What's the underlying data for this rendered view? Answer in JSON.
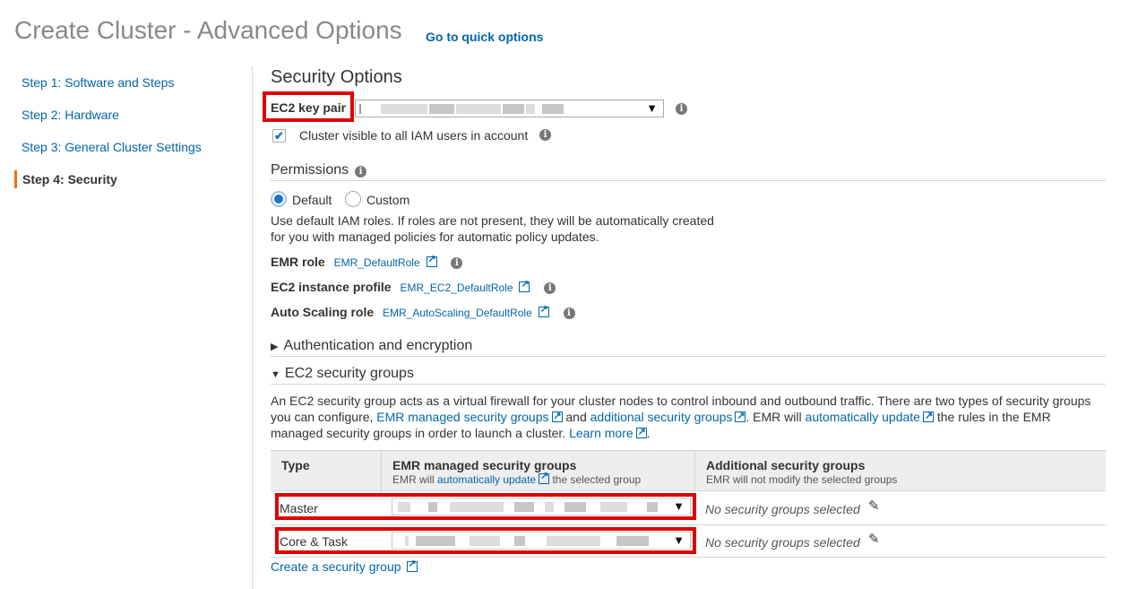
{
  "header": {
    "title": "Create Cluster - Advanced Options",
    "quick_options_link": "Go to quick options"
  },
  "steps": [
    {
      "label": "Step 1: Software and Steps",
      "active": false
    },
    {
      "label": "Step 2: Hardware",
      "active": false
    },
    {
      "label": "Step 3: General Cluster Settings",
      "active": false
    },
    {
      "label": "Step 4: Security",
      "active": true
    }
  ],
  "security": {
    "heading": "Security Options",
    "key_pair_label": "EC2 key pair",
    "key_pair_value": "",
    "cluster_visible_label": "Cluster visible to all IAM users in account",
    "cluster_visible_checked": true
  },
  "permissions": {
    "heading": "Permissions",
    "option_default": "Default",
    "option_custom": "Custom",
    "selected": "Default",
    "description_line1": "Use default IAM roles. If roles are not present, they will be automatically created",
    "description_line2": "for you with managed policies for automatic policy updates.",
    "emr_role_label": "EMR role",
    "emr_role_value": "EMR_DefaultRole",
    "ec2_profile_label": "EC2 instance profile",
    "ec2_profile_value": "EMR_EC2_DefaultRole",
    "autoscaling_label": "Auto Scaling role",
    "autoscaling_value": "EMR_AutoScaling_DefaultRole"
  },
  "auth": {
    "heading": "Authentication and encryption",
    "expanded": false
  },
  "sg": {
    "heading": "EC2 security groups",
    "expanded": true,
    "desc_1": "An EC2 security group acts as a virtual firewall for your cluster nodes to control inbound and outbound traffic. There are two types of security groups",
    "desc_2a": "you can configure,",
    "desc_link_managed": "EMR managed security groups",
    "desc_2b": "and",
    "desc_link_additional": "additional security groups",
    "desc_2c": ". EMR will",
    "desc_link_auto": "automatically update",
    "desc_2d": "the rules in the EMR",
    "desc_3a": "managed security groups in order to launch a cluster.",
    "desc_link_learn": "Learn more",
    "desc_3b": ".",
    "columns": {
      "type": "Type",
      "managed": "EMR managed security groups",
      "managed_sub_a": "EMR will",
      "managed_sub_link": "automatically update",
      "managed_sub_b": "the selected group",
      "additional": "Additional security groups",
      "additional_sub": "EMR will not modify the selected groups"
    },
    "rows": [
      {
        "type": "Master",
        "managed_value": "",
        "additional": "No security groups selected"
      },
      {
        "type": "Core & Task",
        "managed_value": "",
        "additional": "No security groups selected"
      }
    ],
    "create_link": "Create a security group"
  },
  "icons": {
    "info": "info-icon",
    "external": "external-link-icon",
    "edit": "pencil-icon",
    "dropdown": "caret-down-icon"
  },
  "colors": {
    "link": "#0066aa",
    "highlight": "#e00000",
    "active_step_bar": "#ec7211",
    "title": "#888888"
  }
}
